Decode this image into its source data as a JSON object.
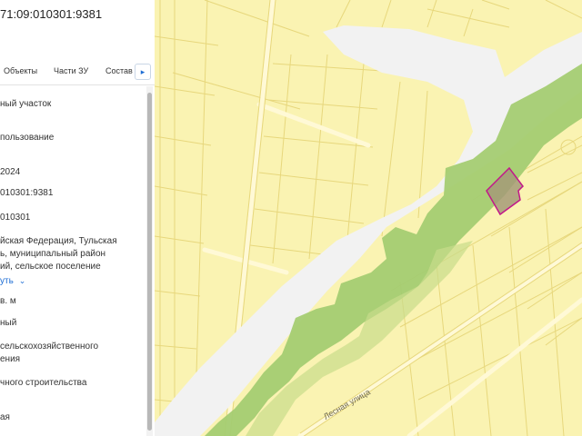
{
  "panel": {
    "title": "71:09:010301:9381",
    "tabs": [
      "Объекты",
      "Части ЗУ",
      "Состав"
    ],
    "next_icon": "chevron-right-icon",
    "fields": [
      "ный участок",
      "пользование",
      "2024",
      "010301:9381",
      "010301",
      "йская Федерация, Тульская",
      "ь, муниципальный район",
      "ий, сельское поселение",
      "уть",
      "в. м",
      "ный",
      "сельскохозяйственного",
      "ения",
      "чного строительства",
      "ая"
    ]
  },
  "map": {
    "street_label": "Лесная улица",
    "colors": {
      "land": "#faf3b2",
      "plot_lines": "#e7d77c",
      "roads": "#fff9d6",
      "river": "#f2f2f2",
      "forest": "#a4cc72",
      "parcel_fill": "#a59a78",
      "parcel_border": "#c2188a"
    }
  }
}
